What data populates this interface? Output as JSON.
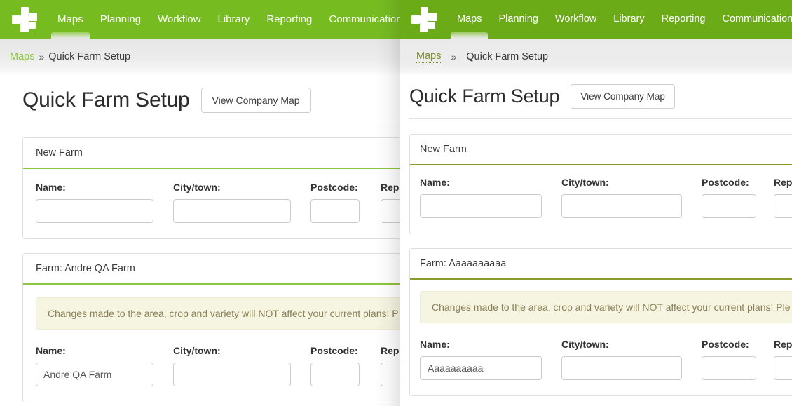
{
  "colors": {
    "brand_green_light": "#76bc21",
    "brand_green_dark": "#6cab18",
    "accent_rule": "#8cc63e",
    "alert_bg": "#f6f5e2",
    "alert_text": "#8a7f56"
  },
  "nav": {
    "items": [
      {
        "label": "Maps",
        "active": true
      },
      {
        "label": "Planning",
        "active": false
      },
      {
        "label": "Workflow",
        "active": false
      },
      {
        "label": "Library",
        "active": false
      },
      {
        "label": "Reporting",
        "active": false
      },
      {
        "label": "Communications",
        "active": false
      }
    ]
  },
  "breadcrumb": {
    "root_label": "Maps",
    "separator": "»",
    "current_label": "Quick Farm Setup"
  },
  "header": {
    "title": "Quick Farm Setup",
    "view_map_button": "View Company Map"
  },
  "form_labels": {
    "name": "Name:",
    "city": "City/town:",
    "postcode": "Postcode:",
    "rep_truncated": "Rep"
  },
  "alert": {
    "text_left": "Changes made to the area, crop and variety will NOT affect your current plans! P",
    "text_right": "Changes made to the area, crop and variety will NOT affect your current plans! Ple"
  },
  "left_panel": {
    "new_farm": {
      "heading": "New Farm",
      "values": {
        "name": "",
        "city": "",
        "postcode": "",
        "rep": ""
      }
    },
    "existing_farm": {
      "heading": "Farm: Andre QA Farm",
      "values": {
        "name": "Andre QA Farm",
        "city": "",
        "postcode": "",
        "rep": ""
      }
    }
  },
  "right_panel": {
    "new_farm": {
      "heading": "New Farm",
      "values": {
        "name": "",
        "city": "",
        "postcode": "",
        "rep": ""
      }
    },
    "existing_farm": {
      "heading": "Farm: Aaaaaaaaaa",
      "values": {
        "name": "Aaaaaaaaaa",
        "city": "",
        "postcode": "",
        "rep": ""
      }
    }
  }
}
